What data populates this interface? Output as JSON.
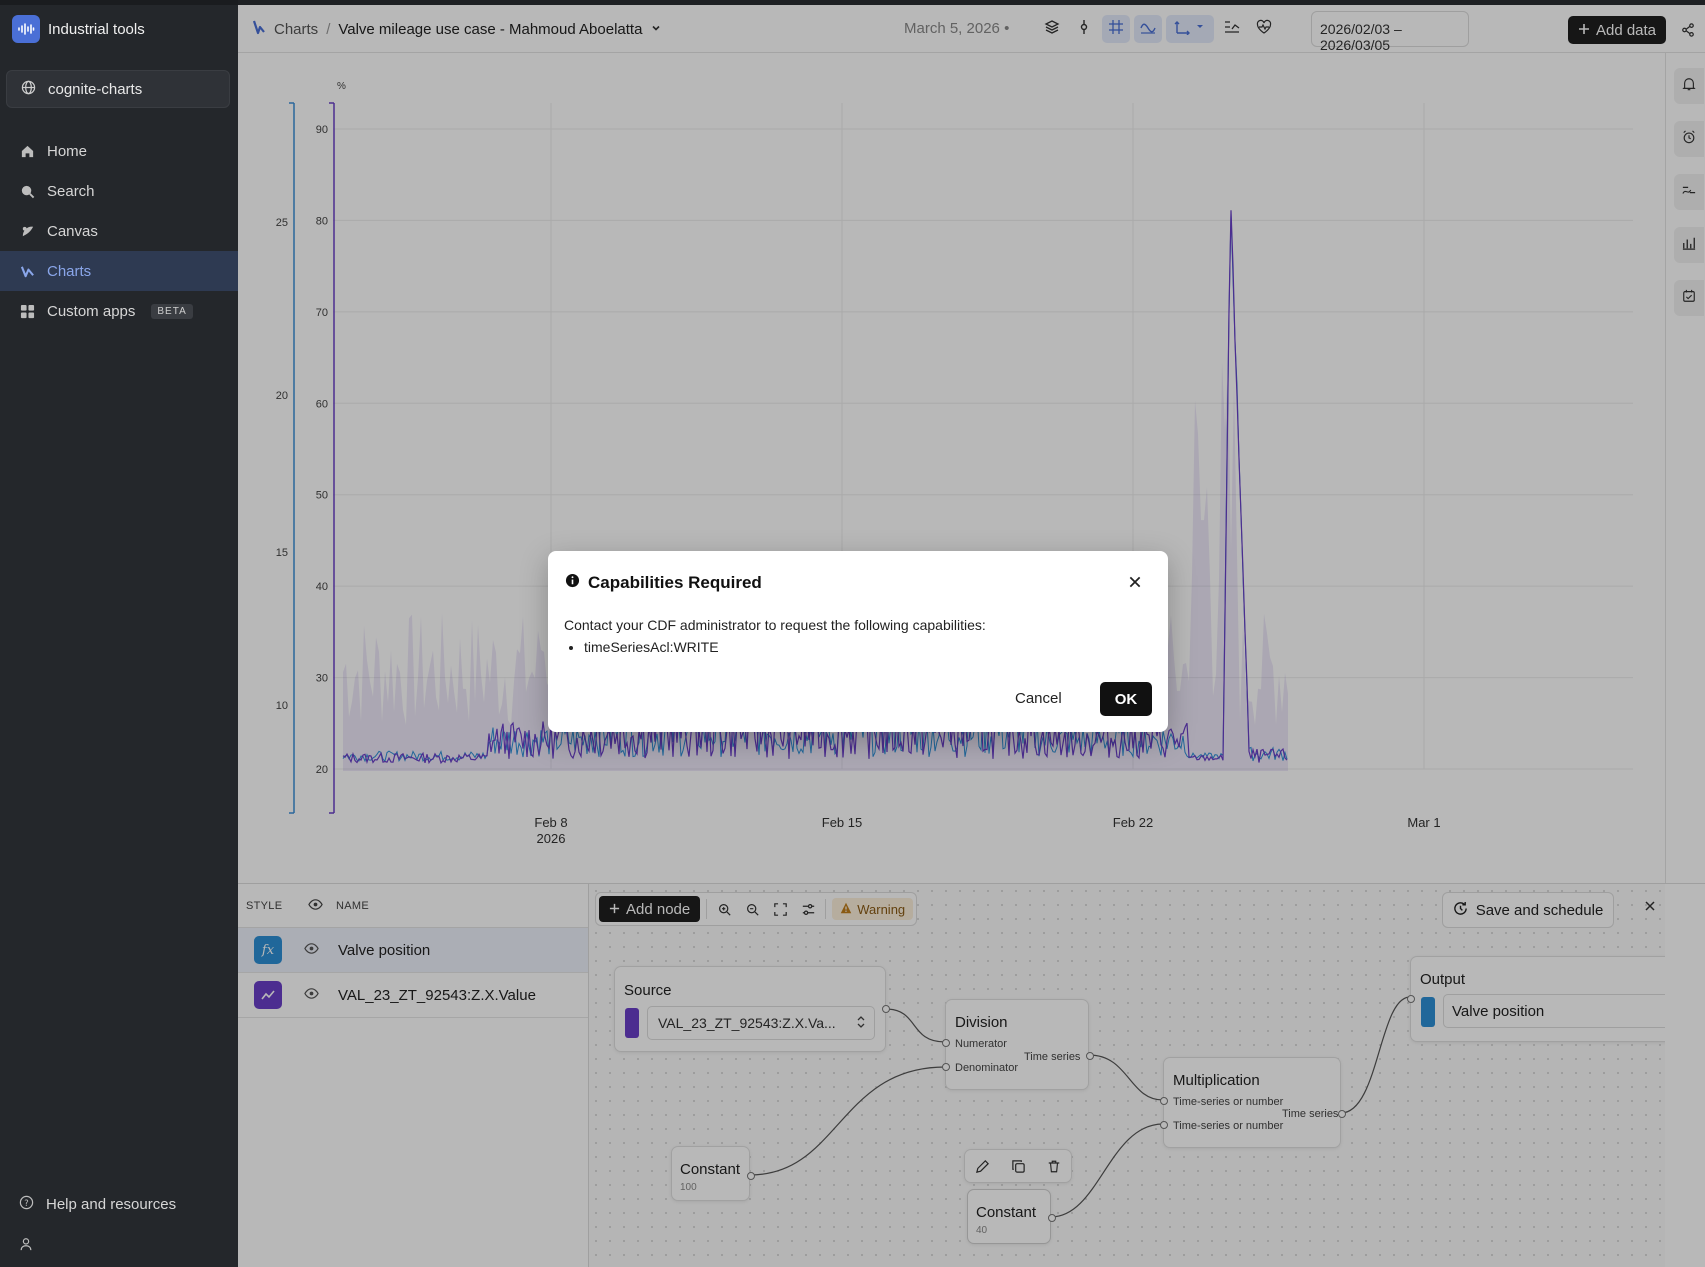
{
  "app": {
    "name": "Industrial tools",
    "project": "cognite-charts"
  },
  "nav": {
    "items": [
      {
        "label": "Home"
      },
      {
        "label": "Search"
      },
      {
        "label": "Canvas"
      },
      {
        "label": "Charts"
      },
      {
        "label": "Custom apps",
        "badge": "BETA"
      }
    ],
    "active": "Charts",
    "help": "Help and resources"
  },
  "header": {
    "breadcrumb_root": "Charts",
    "breadcrumb_sep": "/",
    "title": "Valve mileage use case - Mahmoud Aboelatta",
    "date": "March 5, 2026",
    "date_dot": "•",
    "range": "2026/02/03 – 2026/03/05",
    "add_data": "Add data"
  },
  "chart_data": {
    "type": "line",
    "left_axis": {
      "ticks": [
        "10",
        "15",
        "20",
        "25"
      ],
      "color": "#3b8fd8"
    },
    "right_axis": {
      "unit": "%",
      "ticks": [
        "20",
        "30",
        "40",
        "50",
        "60",
        "70",
        "80",
        "90"
      ],
      "color": "#6a3fc8"
    },
    "x_ticks": [
      "Feb 8",
      "Feb 15",
      "Feb 22",
      "Mar 1"
    ],
    "x_year": "2026",
    "series": [
      {
        "name": "Valve position",
        "color": "#2d8fd6"
      },
      {
        "name": "VAL_23_ZT_92543:Z.X.Value",
        "color": "#6a3fc8"
      }
    ]
  },
  "list": {
    "col_style": "STYLE",
    "col_name": "NAME",
    "rows": [
      {
        "name": "Valve position",
        "color": "#2d8fd6",
        "icon": "function-icon"
      },
      {
        "name": "VAL_23_ZT_92543:Z.X.Value",
        "color": "#6a3fc8",
        "icon": "timeseries-icon"
      }
    ]
  },
  "canvas": {
    "add_node": "Add node",
    "warning": "Warning",
    "save_schedule": "Save and schedule",
    "source": {
      "title": "Source",
      "value": "VAL_23_ZT_92543:Z.X.Va..."
    },
    "division": {
      "title": "Division",
      "in1": "Numerator",
      "in2": "Denominator",
      "out": "Time series"
    },
    "multiplication": {
      "title": "Multiplication",
      "in1": "Time-series or number",
      "in2": "Time-series or number",
      "out": "Time series"
    },
    "output": {
      "title": "Output",
      "value": "Valve position"
    },
    "constant1": {
      "title": "Constant",
      "value": "100"
    },
    "constant2": {
      "title": "Constant",
      "value": "40"
    }
  },
  "modal": {
    "title": "Capabilities Required",
    "body": "Contact your CDF administrator to request the following capabilities:",
    "capability": "timeSeriesAcl:WRITE",
    "cancel": "Cancel",
    "ok": "OK"
  }
}
